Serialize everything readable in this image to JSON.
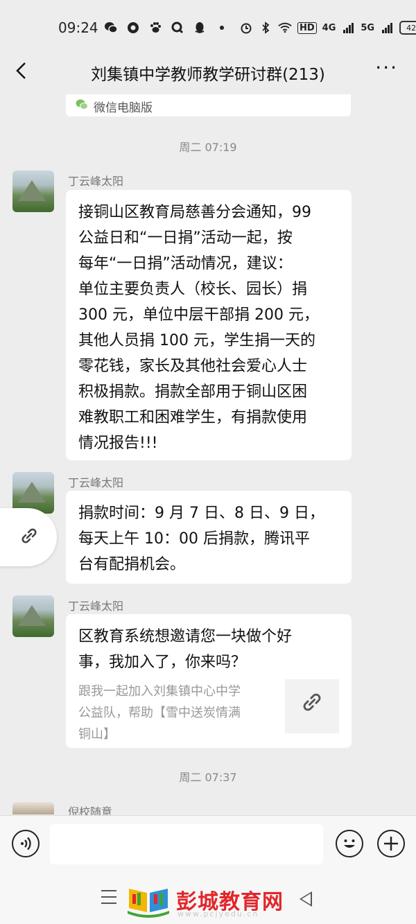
{
  "status_bar": {
    "time": "09:24",
    "network_labels": [
      "HD",
      "4G",
      "5G"
    ],
    "battery": "42"
  },
  "header": {
    "title": "刘集镇中学教师教学研讨群(213)",
    "more": "···"
  },
  "pc_notice": {
    "label": "微信电脑版"
  },
  "messages": {
    "timestamp1": "周二 07:19",
    "m1": {
      "sender": "丁云峰太阳",
      "lines": [
        "接铜山区教育局慈善分会通知，99",
        "公益日和“一日捐”活动一起，按",
        "每年“一日捐”活动情况，建议：",
        "单位主要负责人（校长、园长）捐",
        "300 元，单位中层干部捐 200 元，",
        "其他人员捐 100 元，学生捐一天的",
        "零花钱，家长及其他社会爱心人士",
        "积极捐款。捐款全部用于铜山区困",
        "难教职工和困难学生，有捐款使用",
        "情况报告!!!"
      ]
    },
    "m2": {
      "sender": "丁云峰太阳",
      "lines": [
        "捐款时间：9 月 7 日、8 日、9 日，",
        "每天上午 10：00 后捐款，腾讯平",
        "台有配捐机会。"
      ]
    },
    "m3": {
      "sender": "丁云峰太阳",
      "title_lines": [
        "区教育系统想邀请您一块做个好",
        "事，我加入了，你来吗？"
      ],
      "desc_lines": [
        "跟我一起加入刘集镇中心中学",
        "公益队，帮助【雪中送炭情满",
        "铜山】"
      ]
    },
    "timestamp2": "周二 07:37",
    "m4": {
      "sender": "倪校随意"
    }
  },
  "watermark": {
    "text": "彭城教育网",
    "url": "www.pcjyedu.cn",
    "color": "#e2262b"
  },
  "colors": {
    "background": "#ededed",
    "bubble": "#ffffff"
  }
}
